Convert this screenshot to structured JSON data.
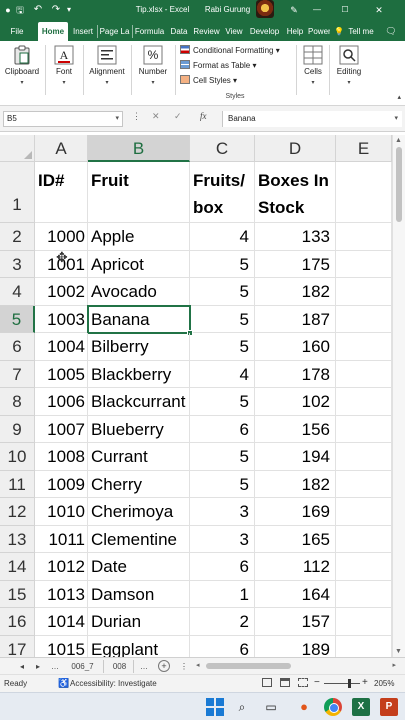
{
  "titlebar": {
    "autosave_icon": "autosave-icon",
    "title": "Tip.xlsx  -  Excel",
    "user": "Rabi Gurung"
  },
  "tabs": [
    "File",
    "Home",
    "Insert",
    "Page La",
    "Formula",
    "Data",
    "Review",
    "View",
    "Develop",
    "Help",
    "Power",
    "Tell me"
  ],
  "ribbon": {
    "clipboard": "Clipboard",
    "font": "Font",
    "alignment": "Alignment",
    "number": "Number",
    "conditional_formatting": "Conditional Formatting",
    "format_as_table": "Format as Table",
    "cell_styles": "Cell Styles",
    "styles_group": "Styles",
    "cells": "Cells",
    "editing": "Editing"
  },
  "formula_bar": {
    "name_box": "B5",
    "fx": "fx",
    "content": "Banana"
  },
  "columns": [
    "A",
    "B",
    "C",
    "D",
    "E"
  ],
  "selected_column": "B",
  "selected_row": "5",
  "rows": [
    {
      "num": "1",
      "a": "ID#",
      "b": "Fruit",
      "c": "Fruits/ box",
      "d": "Boxes In Stock"
    },
    {
      "num": "2",
      "a": "1000",
      "b": "Apple",
      "c": "4",
      "d": "133"
    },
    {
      "num": "3",
      "a": "1001",
      "b": "Apricot",
      "c": "5",
      "d": "175"
    },
    {
      "num": "4",
      "a": "1002",
      "b": "Avocado",
      "c": "5",
      "d": "182"
    },
    {
      "num": "5",
      "a": "1003",
      "b": "Banana",
      "c": "5",
      "d": "187"
    },
    {
      "num": "6",
      "a": "1004",
      "b": "Bilberry",
      "c": "5",
      "d": "160"
    },
    {
      "num": "7",
      "a": "1005",
      "b": "Blackberry",
      "c": "4",
      "d": "178"
    },
    {
      "num": "8",
      "a": "1006",
      "b": "Blackcurrant",
      "c": "5",
      "d": "102"
    },
    {
      "num": "9",
      "a": "1007",
      "b": "Blueberry",
      "c": "6",
      "d": "156"
    },
    {
      "num": "10",
      "a": "1008",
      "b": "Currant",
      "c": "5",
      "d": "194"
    },
    {
      "num": "11",
      "a": "1009",
      "b": "Cherry",
      "c": "5",
      "d": "182"
    },
    {
      "num": "12",
      "a": "1010",
      "b": "Cherimoya",
      "c": "3",
      "d": "169"
    },
    {
      "num": "13",
      "a": "1011",
      "b": "Clementine",
      "c": "3",
      "d": "165"
    },
    {
      "num": "14",
      "a": "1012",
      "b": "Date",
      "c": "6",
      "d": "112"
    },
    {
      "num": "15",
      "a": "1013",
      "b": "Damson",
      "c": "1",
      "d": "164"
    },
    {
      "num": "16",
      "a": "1014",
      "b": "Durian",
      "c": "2",
      "d": "157"
    },
    {
      "num": "17",
      "a": "1015",
      "b": "Eggplant",
      "c": "6",
      "d": "189"
    }
  ],
  "sheets": [
    "006_7",
    "008"
  ],
  "status": {
    "ready": "Ready",
    "accessibility": "Accessibility: Investigate",
    "zoom": "205%"
  },
  "colors": {
    "excel_green": "#1e6e40",
    "selection_green": "#217346",
    "header_gray": "#efefef"
  }
}
